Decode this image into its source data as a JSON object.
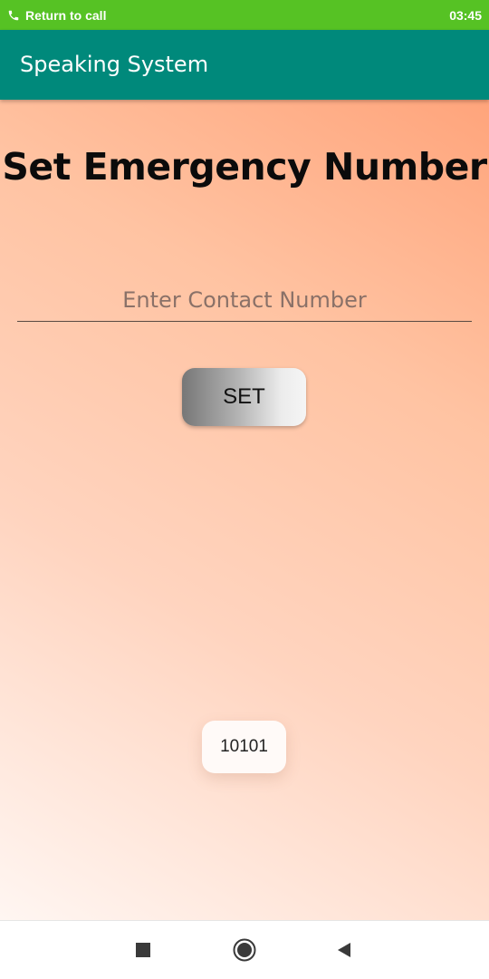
{
  "status_bar": {
    "call_text": "Return to call",
    "time": "03:45",
    "background": "#56c224"
  },
  "app_bar": {
    "title": "Speaking System",
    "background": "#00897b"
  },
  "main": {
    "heading": "Set Emergency Number",
    "contact_placeholder": "Enter Contact Number",
    "contact_value": "",
    "set_button_label": "SET"
  },
  "toast": {
    "text": "10101"
  },
  "nav_bar": {
    "icons": [
      "recent-apps-icon",
      "home-icon",
      "back-icon"
    ]
  }
}
